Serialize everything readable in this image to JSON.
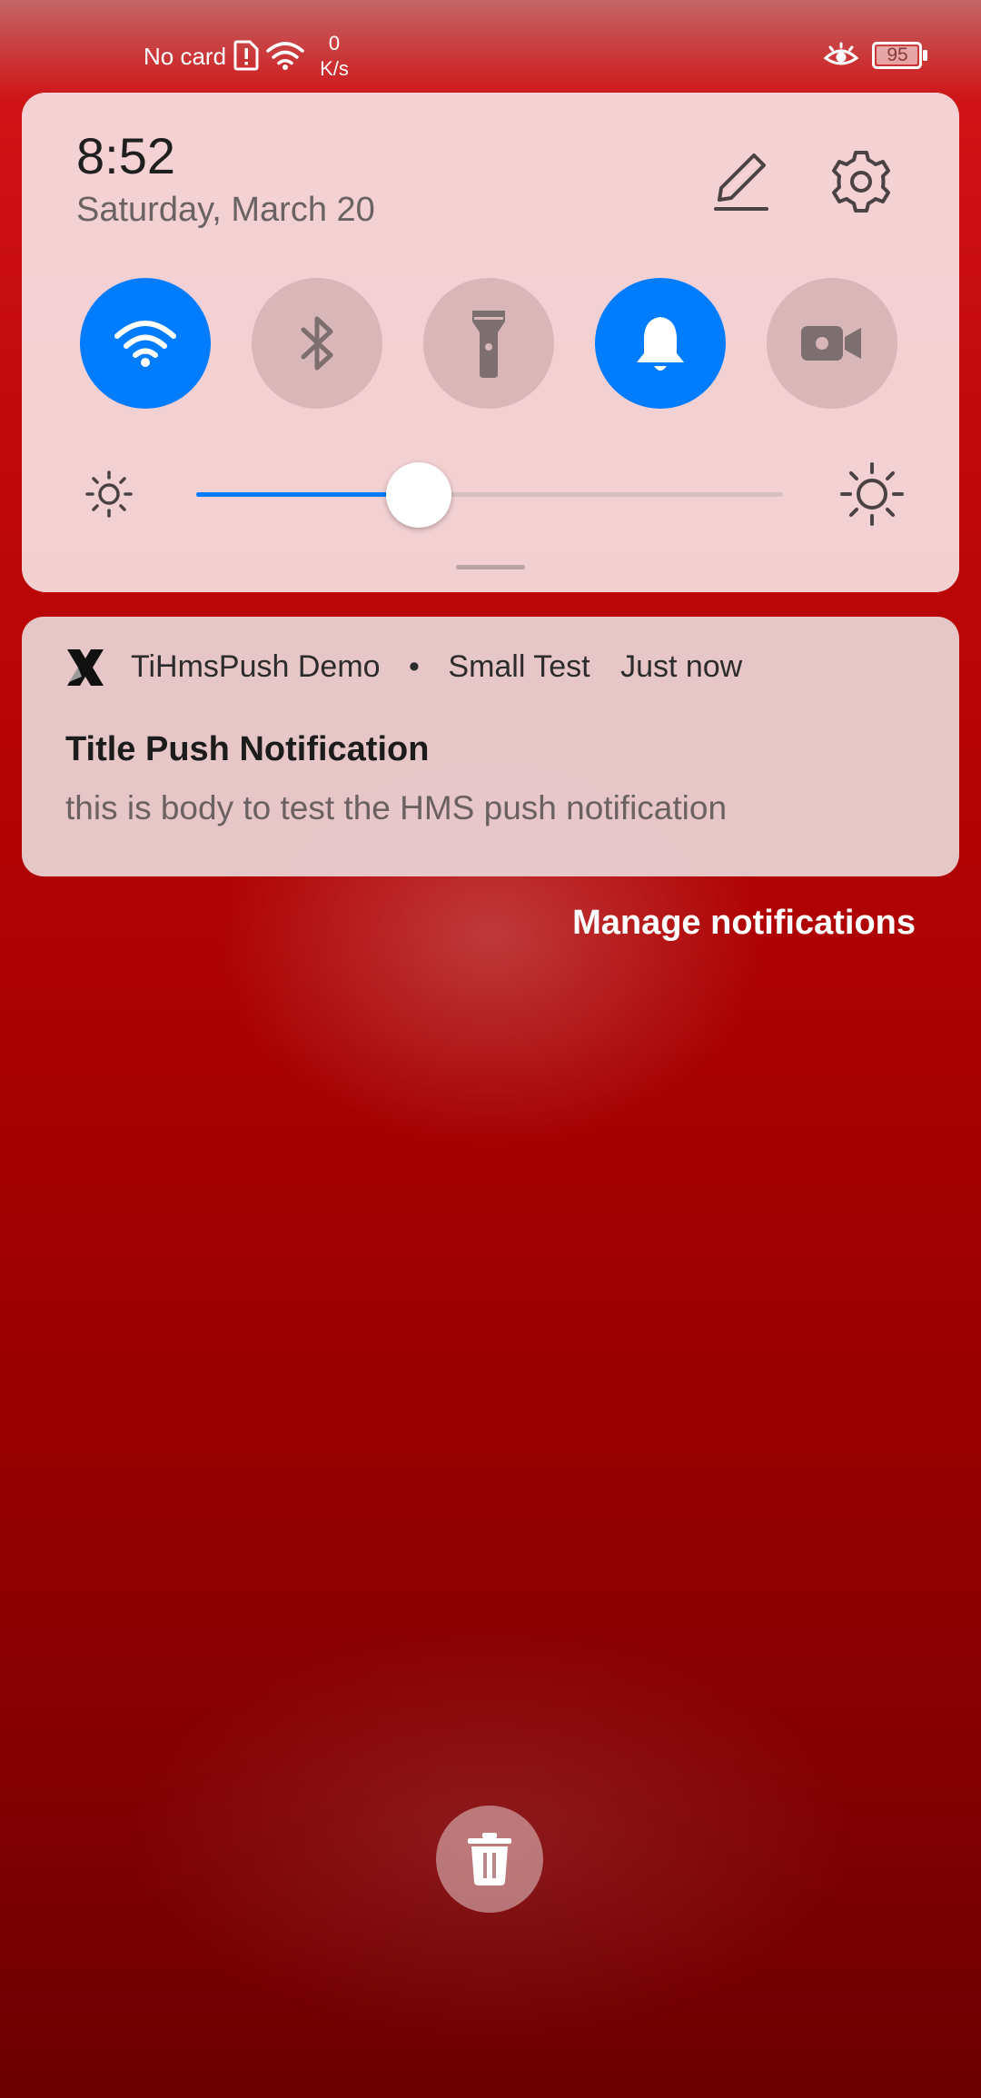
{
  "status_bar": {
    "carrier": "No card",
    "net_speed_value": "0",
    "net_speed_unit": "K/s",
    "battery": "95",
    "icons": [
      "sim-alert-icon",
      "wifi-icon",
      "eye-comfort-icon",
      "battery-icon"
    ]
  },
  "quick_settings": {
    "time": "8:52",
    "date": "Saturday, March 20",
    "tiles": [
      {
        "name": "wifi",
        "icon": "wifi-icon",
        "state": "on"
      },
      {
        "name": "bluetooth",
        "icon": "bluetooth-icon",
        "state": "off"
      },
      {
        "name": "flashlight",
        "icon": "flashlight-icon",
        "state": "off"
      },
      {
        "name": "sound",
        "icon": "bell-icon",
        "state": "on"
      },
      {
        "name": "screen-recorder",
        "icon": "video-camera-icon",
        "state": "off"
      }
    ],
    "brightness_level": 0.38,
    "accent_color": "#007dff"
  },
  "notification": {
    "app_name": "TiHmsPush Demo",
    "separator": "•",
    "subtext": "Small Test",
    "time": "Just now",
    "title": "Title Push Notification",
    "body": "this is body to test the HMS push notification"
  },
  "manage_notifications_label": "Manage notifications"
}
